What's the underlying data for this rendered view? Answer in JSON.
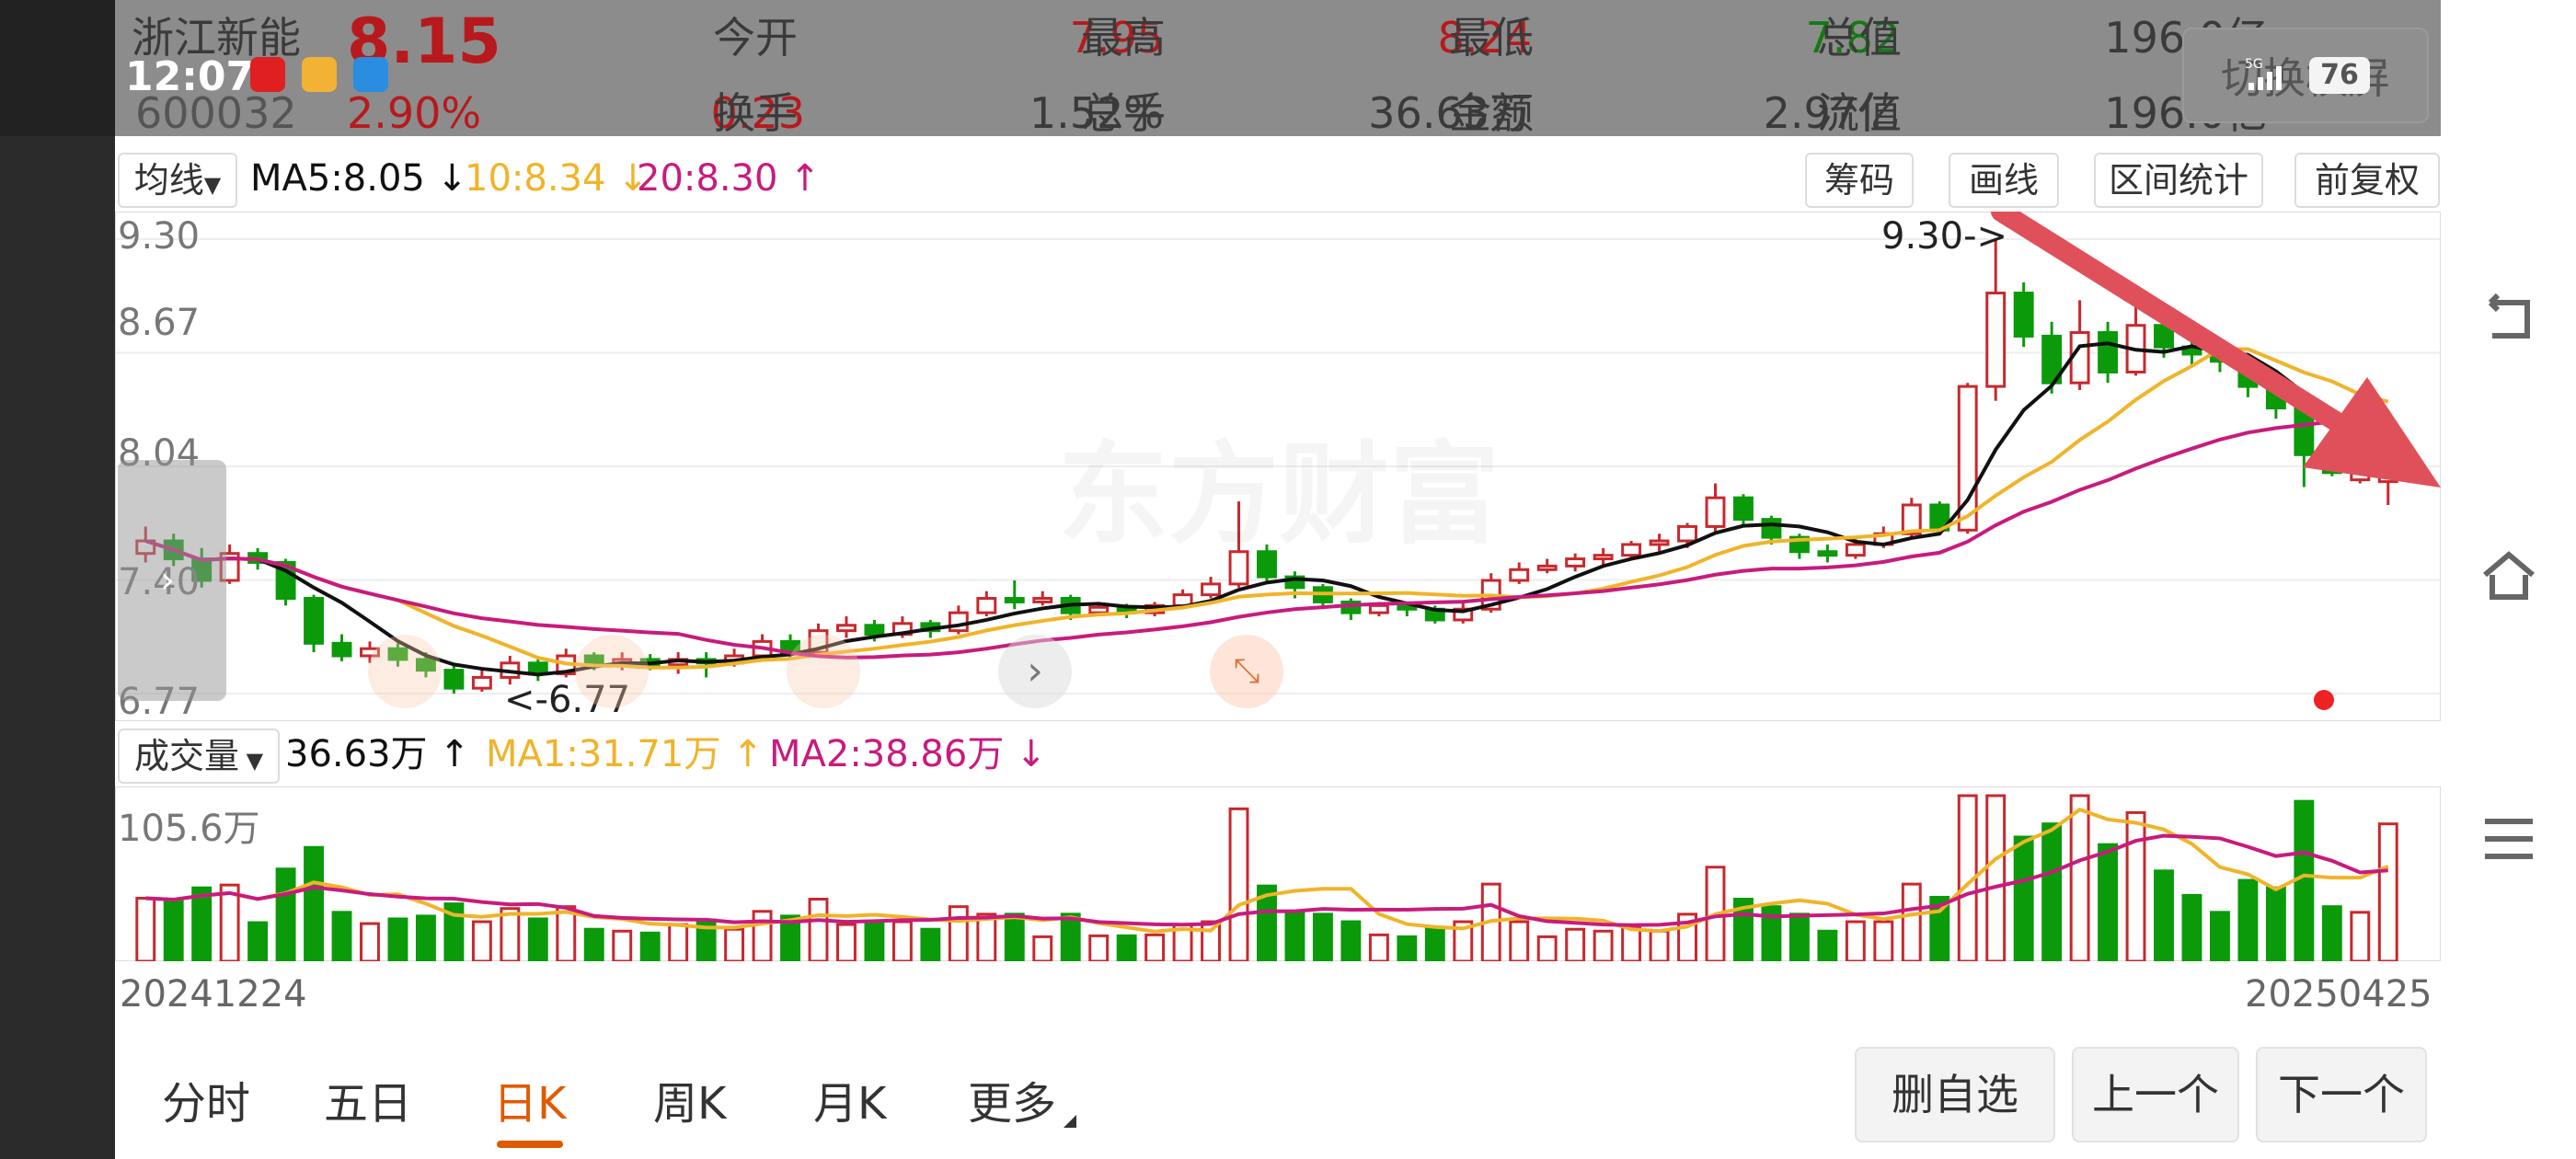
{
  "status": {
    "time": "12:07",
    "network": "5G",
    "battery": "76"
  },
  "stock": {
    "name": "浙江新能",
    "code": "600032",
    "price": "8.15",
    "change_pct": "2.90%",
    "change": "0.23",
    "stats": [
      {
        "label": "今开",
        "value": "7.95",
        "color": "red"
      },
      {
        "label": "最高",
        "value": "8.24",
        "color": "red"
      },
      {
        "label": "最低",
        "value": "7.82",
        "color": "green"
      },
      {
        "label": "总值",
        "value": "196.0亿",
        "color": "dark"
      },
      {
        "label": "换手",
        "value": "1.52%",
        "color": "dark"
      },
      {
        "label": "总手",
        "value": "36.63万",
        "color": "dark"
      },
      {
        "label": "金额",
        "value": "2.97亿",
        "color": "dark"
      },
      {
        "label": "流值",
        "value": "196.0亿",
        "color": "dark"
      }
    ],
    "switch_label": "切换横屏"
  },
  "toolbar": {
    "indicator_select": "均线",
    "ma5": "MA5:8.05",
    "ma10": "10:8.34",
    "ma20": "20:8.30",
    "buttons": [
      "筹码",
      "画线",
      "区间统计",
      "前复权"
    ]
  },
  "kline": {
    "y_ticks": [
      "9.30",
      "8.67",
      "8.04",
      "7.40",
      "6.77"
    ],
    "high_marker": "9.30->",
    "low_marker": "<-6.77",
    "watermark": "东方财富"
  },
  "volume": {
    "indicator_select": "成交量",
    "current": "36.63万",
    "ma1": "MA1:31.71万",
    "ma2": "MA2:38.86万",
    "y_tick": "105.6万"
  },
  "dates": {
    "start": "20241224",
    "end": "20250425"
  },
  "tabs": [
    "分时",
    "五日",
    "日K",
    "周K",
    "月K",
    "更多"
  ],
  "active_tab": "日K",
  "actions": [
    "删自选",
    "上一个",
    "下一个"
  ],
  "colors": {
    "up": "#c8282d",
    "down": "#0a9a0a",
    "ma5": "#111111",
    "ma10": "#f0b429",
    "ma20": "#c81b7e",
    "annotation_arrow": "#e0505a"
  },
  "chart_data": {
    "type": "candlestick",
    "x_range": [
      "20241224",
      "20250425"
    ],
    "ylim": [
      6.77,
      9.3
    ],
    "candles": [
      [
        7.55,
        7.62,
        7.7,
        7.5
      ],
      [
        7.62,
        7.52,
        7.66,
        7.48
      ],
      [
        7.52,
        7.4,
        7.58,
        7.36
      ],
      [
        7.4,
        7.55,
        7.6,
        7.38
      ],
      [
        7.55,
        7.5,
        7.58,
        7.46
      ],
      [
        7.5,
        7.3,
        7.52,
        7.26
      ],
      [
        7.3,
        7.05,
        7.32,
        7.0
      ],
      [
        7.05,
        6.98,
        7.1,
        6.95
      ],
      [
        6.98,
        7.02,
        7.06,
        6.94
      ],
      [
        7.02,
        6.96,
        7.05,
        6.92
      ],
      [
        6.96,
        6.9,
        7.0,
        6.86
      ],
      [
        6.9,
        6.8,
        6.94,
        6.77
      ],
      [
        6.8,
        6.86,
        6.9,
        6.78
      ],
      [
        6.86,
        6.94,
        6.98,
        6.82
      ],
      [
        6.94,
        6.88,
        6.97,
        6.84
      ],
      [
        6.88,
        6.98,
        7.02,
        6.86
      ],
      [
        6.98,
        6.94,
        7.0,
        6.9
      ],
      [
        6.94,
        6.96,
        7.0,
        6.9
      ],
      [
        6.96,
        6.93,
        6.99,
        6.9
      ],
      [
        6.93,
        6.96,
        7.0,
        6.88
      ],
      [
        6.96,
        6.94,
        7.0,
        6.86
      ],
      [
        6.94,
        6.98,
        7.02,
        6.92
      ],
      [
        6.98,
        7.06,
        7.1,
        6.95
      ],
      [
        7.06,
        7.0,
        7.1,
        6.96
      ],
      [
        7.0,
        7.12,
        7.16,
        6.98
      ],
      [
        7.12,
        7.15,
        7.2,
        7.08
      ],
      [
        7.15,
        7.1,
        7.18,
        7.06
      ],
      [
        7.1,
        7.16,
        7.2,
        7.08
      ],
      [
        7.16,
        7.12,
        7.18,
        7.08
      ],
      [
        7.12,
        7.22,
        7.26,
        7.1
      ],
      [
        7.22,
        7.3,
        7.34,
        7.2
      ],
      [
        7.3,
        7.28,
        7.4,
        7.24
      ],
      [
        7.28,
        7.3,
        7.34,
        7.26
      ],
      [
        7.3,
        7.22,
        7.32,
        7.18
      ],
      [
        7.22,
        7.25,
        7.28,
        7.2
      ],
      [
        7.25,
        7.22,
        7.27,
        7.19
      ],
      [
        7.22,
        7.26,
        7.28,
        7.2
      ],
      [
        7.26,
        7.32,
        7.35,
        7.24
      ],
      [
        7.32,
        7.38,
        7.42,
        7.3
      ],
      [
        7.38,
        7.56,
        7.84,
        7.36
      ],
      [
        7.56,
        7.42,
        7.6,
        7.38
      ],
      [
        7.42,
        7.36,
        7.45,
        7.3
      ],
      [
        7.36,
        7.28,
        7.38,
        7.24
      ],
      [
        7.28,
        7.22,
        7.3,
        7.18
      ],
      [
        7.22,
        7.26,
        7.28,
        7.2
      ],
      [
        7.26,
        7.24,
        7.28,
        7.2
      ],
      [
        7.24,
        7.18,
        7.26,
        7.16
      ],
      [
        7.18,
        7.24,
        7.28,
        7.16
      ],
      [
        7.24,
        7.4,
        7.44,
        7.22
      ],
      [
        7.4,
        7.46,
        7.5,
        7.38
      ],
      [
        7.46,
        7.48,
        7.52,
        7.44
      ],
      [
        7.48,
        7.52,
        7.55,
        7.45
      ],
      [
        7.52,
        7.54,
        7.58,
        7.48
      ],
      [
        7.54,
        7.6,
        7.62,
        7.52
      ],
      [
        7.6,
        7.62,
        7.66,
        7.56
      ],
      [
        7.62,
        7.7,
        7.72,
        7.58
      ],
      [
        7.7,
        7.86,
        7.94,
        7.66
      ],
      [
        7.86,
        7.74,
        7.88,
        7.7
      ],
      [
        7.74,
        7.64,
        7.76,
        7.6
      ],
      [
        7.64,
        7.56,
        7.66,
        7.52
      ],
      [
        7.56,
        7.54,
        7.6,
        7.5
      ],
      [
        7.54,
        7.6,
        7.64,
        7.52
      ],
      [
        7.6,
        7.66,
        7.7,
        7.58
      ],
      [
        7.66,
        7.82,
        7.86,
        7.64
      ],
      [
        7.82,
        7.68,
        7.84,
        7.66
      ],
      [
        7.68,
        8.48,
        8.5,
        7.66
      ],
      [
        8.48,
        9.0,
        9.3,
        8.4
      ],
      [
        9.0,
        8.76,
        9.06,
        8.7
      ],
      [
        8.76,
        8.5,
        8.84,
        8.44
      ],
      [
        8.5,
        8.78,
        8.96,
        8.46
      ],
      [
        8.78,
        8.56,
        8.84,
        8.5
      ],
      [
        8.56,
        8.82,
        8.98,
        8.54
      ],
      [
        8.82,
        8.7,
        8.92,
        8.64
      ],
      [
        8.7,
        8.66,
        8.82,
        8.6
      ],
      [
        8.66,
        8.62,
        8.72,
        8.56
      ],
      [
        8.62,
        8.48,
        8.66,
        8.42
      ],
      [
        8.48,
        8.36,
        8.52,
        8.3
      ],
      [
        8.36,
        8.1,
        8.4,
        7.92
      ],
      [
        8.1,
        8.0,
        8.14,
        7.98
      ],
      [
        7.96,
        8.06,
        8.08,
        7.94
      ],
      [
        7.95,
        8.15,
        8.24,
        7.82
      ]
    ],
    "volume_ylim": [
      0,
      105.6
    ]
  }
}
